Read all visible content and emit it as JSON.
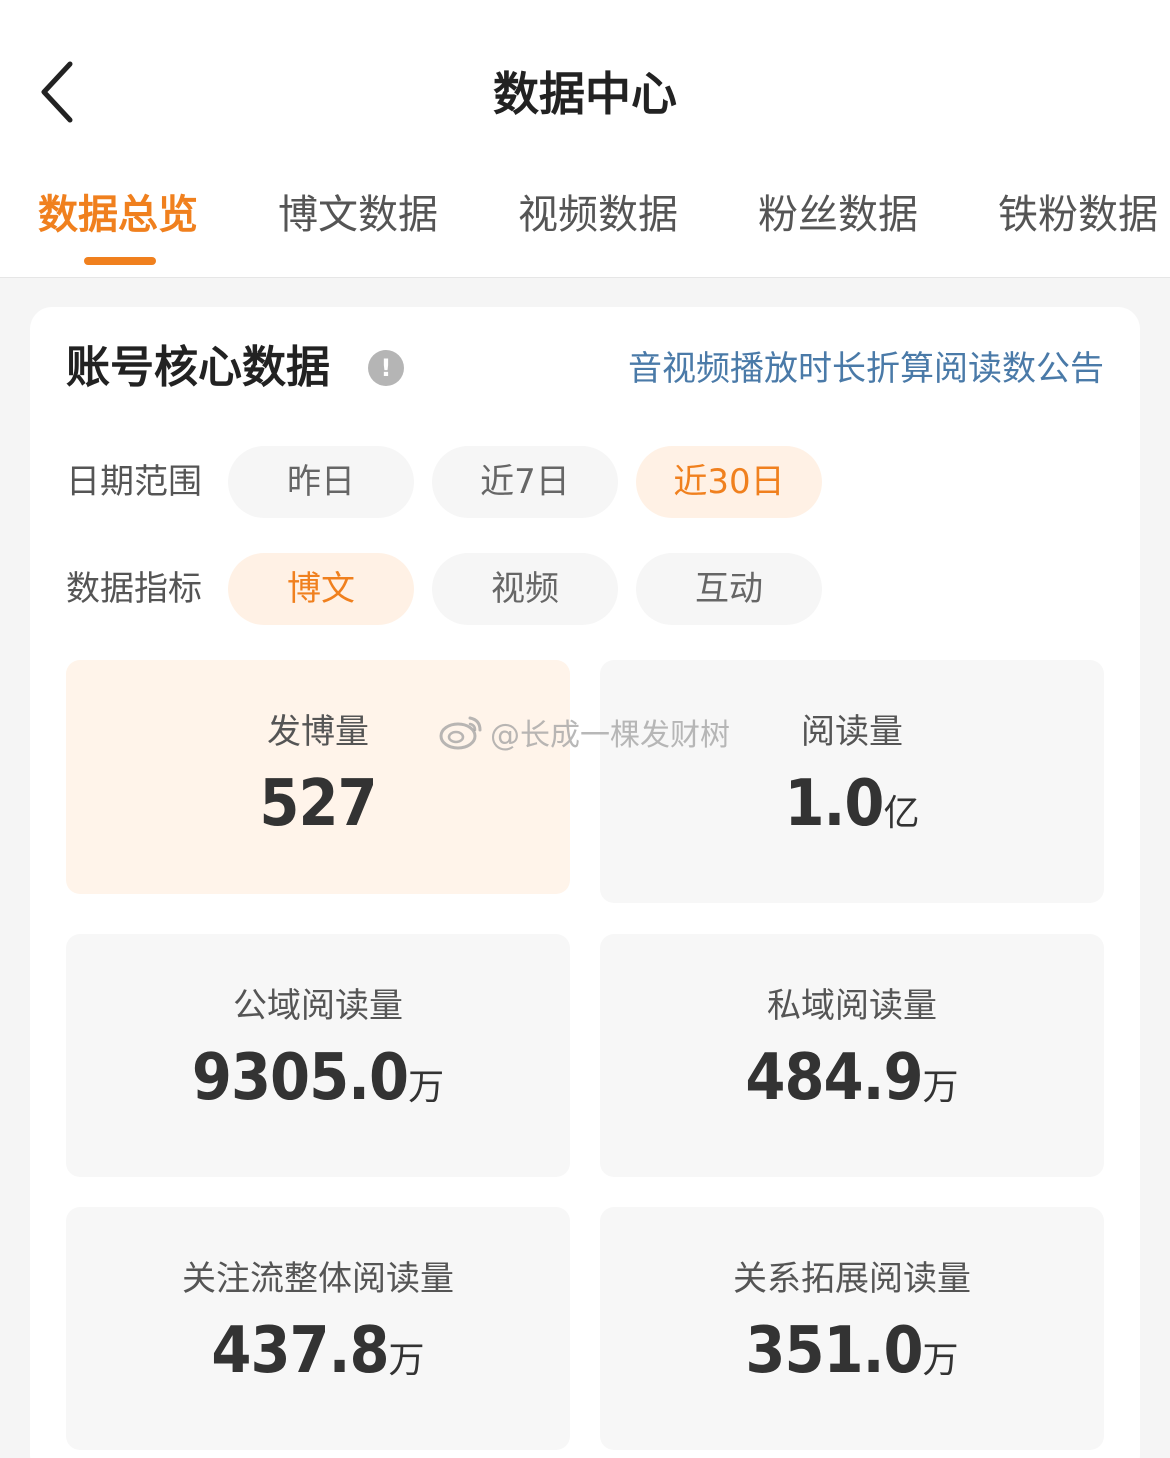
{
  "header": {
    "title": "数据中心"
  },
  "tabs": [
    {
      "label": "数据总览",
      "active": true
    },
    {
      "label": "博文数据",
      "active": false
    },
    {
      "label": "视频数据",
      "active": false
    },
    {
      "label": "粉丝数据",
      "active": false
    },
    {
      "label": "铁粉数据",
      "active": false
    }
  ],
  "card": {
    "title": "账号核心数据",
    "info_icon_glyph": "!",
    "notice_link": "音视频播放时长折算阅读数公告",
    "date_range": {
      "label": "日期范围",
      "options": [
        "昨日",
        "近7日",
        "近30日"
      ],
      "selected": "近30日"
    },
    "metric_type": {
      "label": "数据指标",
      "options": [
        "博文",
        "视频",
        "互动"
      ],
      "selected": "博文"
    },
    "metrics": [
      {
        "label": "发博量",
        "value": "527",
        "unit": ""
      },
      {
        "label": "阅读量",
        "value": "1.0",
        "unit": "亿"
      },
      {
        "label": "公域阅读量",
        "value": "9305.0",
        "unit": "万"
      },
      {
        "label": "私域阅读量",
        "value": "484.9",
        "unit": "万"
      },
      {
        "label": "关注流整体阅读量",
        "value": "437.8",
        "unit": "万"
      },
      {
        "label": "关系拓展阅读量",
        "value": "351.0",
        "unit": "万"
      }
    ]
  },
  "watermark": {
    "text": "@长成一棵发财树"
  },
  "colors": {
    "accent": "#f0801e",
    "link": "#4a7aa8",
    "chip_active_bg": "#fff1e5"
  }
}
